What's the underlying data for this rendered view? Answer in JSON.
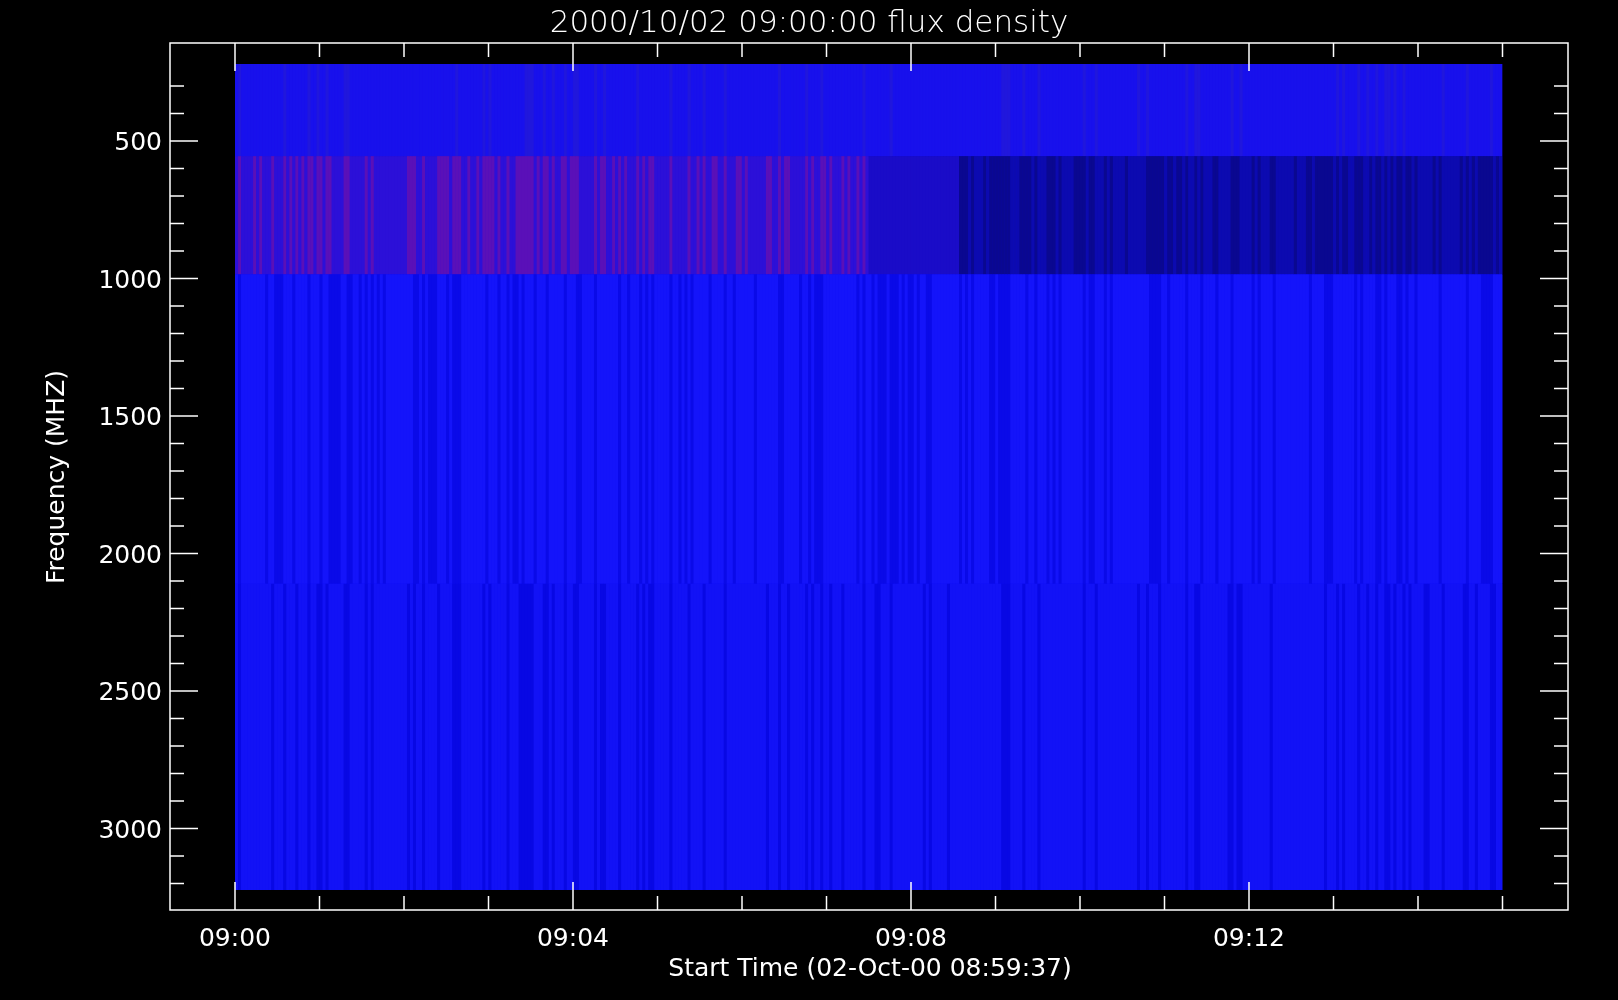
{
  "title": "2000/10/02 09:00:00 flux density",
  "plot": {
    "ylabel": "Frequency (MHZ)",
    "xlabel": "Start Time (02-Oct-00 08:59:37)",
    "yticks": [
      "500",
      "1000",
      "1500",
      "2000",
      "2500",
      "3000"
    ],
    "xticks": [
      "09:00",
      "09:04",
      "09:08",
      "09:12"
    ]
  }
}
